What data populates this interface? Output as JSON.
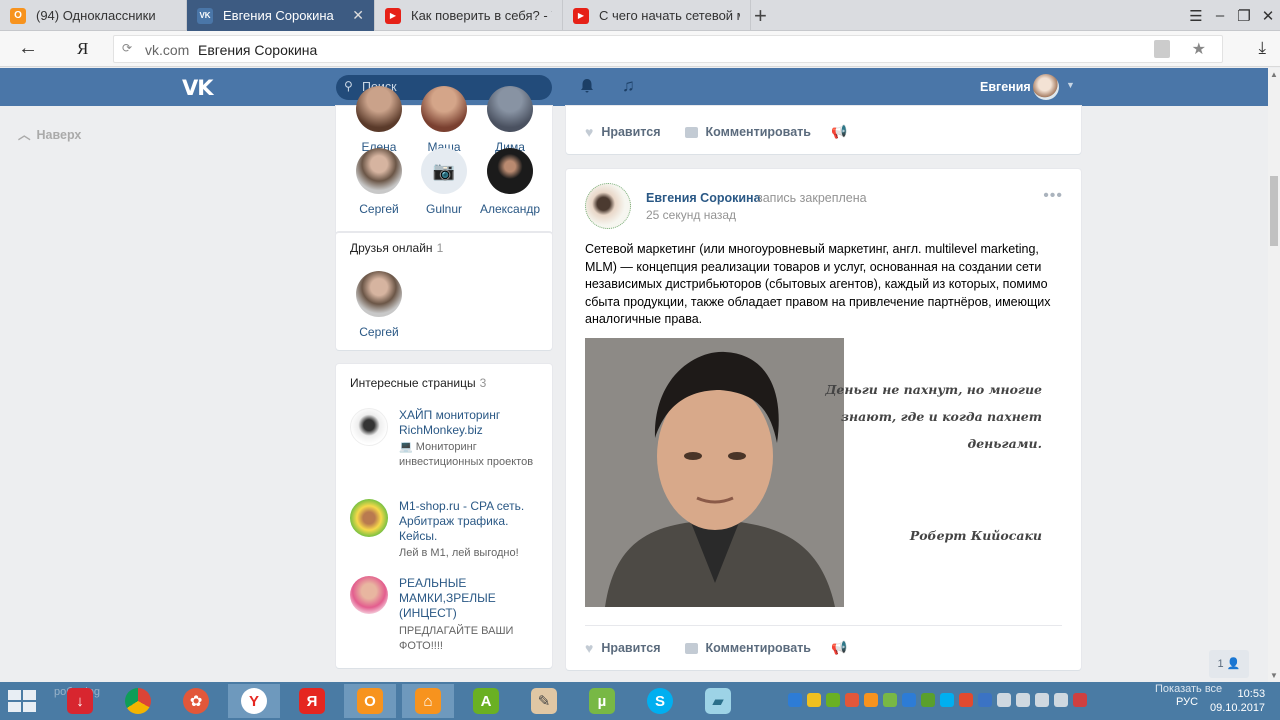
{
  "browser": {
    "tabs": [
      {
        "title": "(94) Одноклассники",
        "favicon_color": "#f7931e",
        "favicon_char": "О"
      },
      {
        "title": "Евгения Сорокина",
        "favicon_color": "#4a76a8",
        "favicon_char": "VK",
        "active": true
      },
      {
        "title": "Как поверить в себя? - You",
        "favicon_color": "#e62117",
        "favicon_char": "▶"
      },
      {
        "title": "С чего начать сетевой мар",
        "favicon_color": "#e62117",
        "favicon_char": "▶"
      }
    ],
    "new_tab_symbol": "+",
    "address": {
      "domain": "vk.com",
      "page_title": "Евгения Сорокина"
    },
    "yandex_label": "Я"
  },
  "vk": {
    "search_placeholder": "Поиск",
    "user_name": "Евгения",
    "nav_top": "Наверх",
    "accent": "#4a76a8"
  },
  "friends": {
    "row1": [
      {
        "name": "Елена"
      },
      {
        "name": "Маша"
      },
      {
        "name": "Дима"
      }
    ],
    "row2": [
      {
        "name": "Сергей"
      },
      {
        "name": "Gulnur"
      },
      {
        "name": "Александр"
      }
    ],
    "online_label": "Друзья онлайн",
    "online_count": "1",
    "online": [
      {
        "name": "Сергей"
      }
    ]
  },
  "interesting": {
    "label": "Интересные страницы",
    "count": "3",
    "pages": [
      {
        "name": "ХАЙП мониторинг RichMonkey.biz",
        "desc": "💻 Мониторинг инвестиционных проектов"
      },
      {
        "name": "M1-shop.ru - CPA сеть. Арбитраж трафика. Кейсы.",
        "desc": "Лей в М1, лей выгодно!"
      },
      {
        "name": "РЕАЛЬНЫЕ МАМКИ,ЗРЕЛЫЕ (ИНЦЕСТ)",
        "desc": "ПРЕДЛАГАЙТЕ ВАШИ ФОТО!!!!"
      }
    ]
  },
  "actions": {
    "like": "Нравится",
    "comment": "Комментировать"
  },
  "post": {
    "author": "Евгения Сорокина",
    "pinned": "запись закреплена",
    "time": "25 секунд назад",
    "text": "Сетевой маркетинг (или многоуровневый маркетинг, англ. multilevel marketing, MLM) — концепция реализации товаров и услуг, основанная на создании сети независимых дистрибьюторов (сбытовых агентов), каждый из которых, помимо сбыта продукции, также обладает правом на привлечение партнёров, имеющих аналогичные права.",
    "quote_lines": [
      "Деньги не пахнут, но многие",
      "знают, где и когда пахнет",
      "деньгами."
    ],
    "quote_author": "Роберт Кийосаки"
  },
  "page_badge": "1",
  "taskbar": {
    "file_label": "робот.jpg",
    "show_all": "Показать все",
    "lang": "РУС",
    "time": "10:53",
    "date": "09.10.2017"
  }
}
